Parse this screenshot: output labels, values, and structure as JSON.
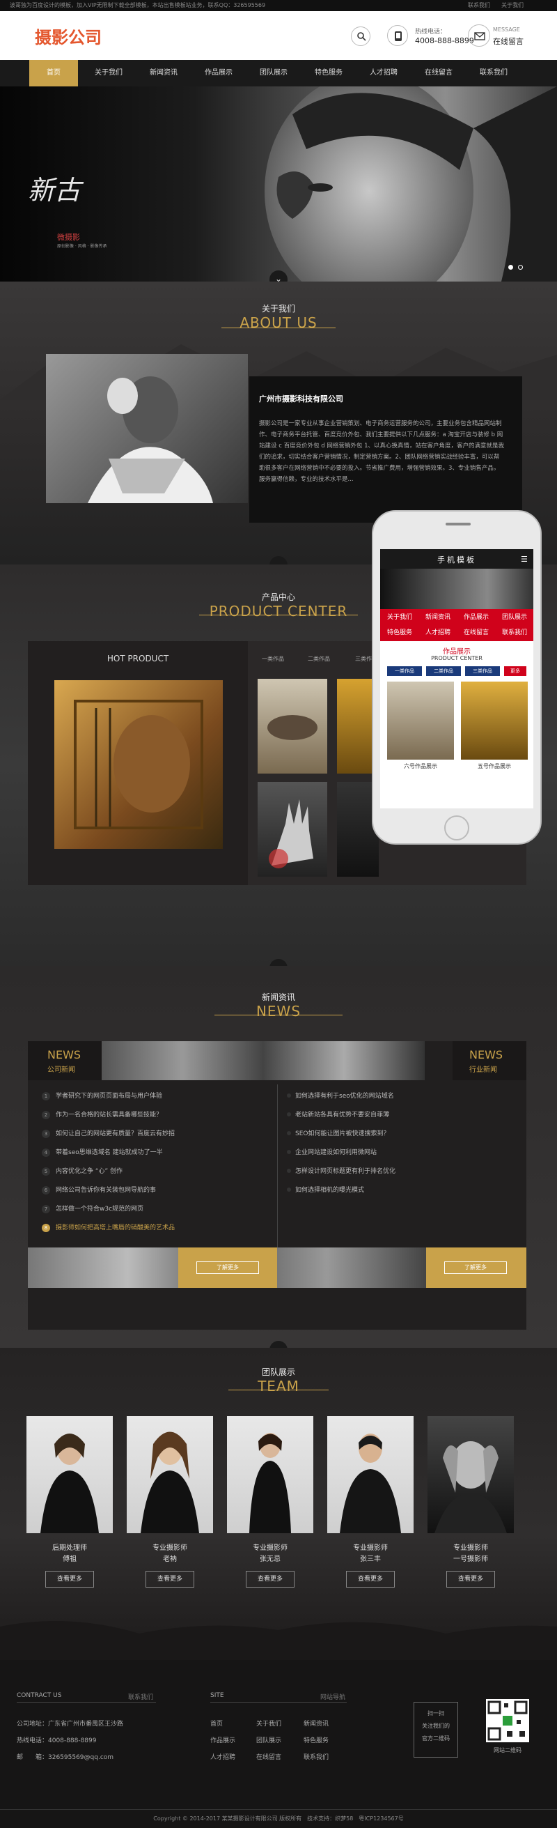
{
  "topbar": {
    "notice": "波哥独为百度设计的模板，加入VIP无限制下载全部模板，本站出售模板站业务，联系QQ：326595569",
    "links": [
      "联系我们",
      "关于我们"
    ]
  },
  "header": {
    "logo": "摄影公司",
    "hotline_label": "热线电话：",
    "hotline_number": "4008-888-8899",
    "message_en": "MESSAGE",
    "message_cn": "在线留言"
  },
  "nav": [
    "首页",
    "关于我们",
    "新闻资讯",
    "作品展示",
    "团队展示",
    "特色服务",
    "人才招聘",
    "在线留言",
    "联系我们"
  ],
  "banner": {
    "calligraphy": "新古",
    "brand": "微摄影",
    "subtitle": "原创影像 · 风格 · 影像传承"
  },
  "about": {
    "title_cn": "关于我们",
    "title_en": "ABOUT US",
    "company": "广州市摄影科技有限公司",
    "text": "摄影公司是一家专业从事企业营销策划、电子商务运营服务的公司，主要业务包含精品网站制作、电子商务平台托管、百度竞价外包、我们主要提供以下几点服务：a 淘宝开店与装修 b 网站建设 c 百度竞价外包 d 网络营销外包 1、以真心换真情，站在客户角度，客户的满意就是我们的追求，切实结合客户营销情况，制定营销方案。2、团队网络营销实战经验丰富，可以帮助很多客户在网络营销中不必要的投入。节省推广费用，增强营销效果。3、专业销售产品，服务赢得信赖，专业的技术水平是..."
  },
  "products": {
    "title_cn": "产品中心",
    "title_en": "PRODUCT CENTER",
    "hot_label": "HOT PRODUCT",
    "tabs": [
      "一类作品",
      "二类作品",
      "三类作品"
    ]
  },
  "phone": {
    "header": "手机模板",
    "menu": [
      "关于我们",
      "新闻资讯",
      "作品展示",
      "团队展示",
      "特色服务",
      "人才招聘",
      "在线留言",
      "联系我们"
    ],
    "section_cn": "作品展示",
    "section_en": "PRODUCT CENTER",
    "tabs": [
      "一类作品",
      "二类作品",
      "三类作品",
      "更多"
    ],
    "items": [
      "六号作品展示",
      "五号作品展示"
    ]
  },
  "news": {
    "title_cn": "新闻资讯",
    "title_en": "NEWS",
    "left_en": "NEWS",
    "left_cn": "公司新闻",
    "right_en": "NEWS",
    "right_cn": "行业新闻",
    "left_items": [
      "学者研究下的网页页面布局与用户体验",
      "作为一名合格的站长需具备哪些技能？",
      "如何让自己的网站更有质量？百度云有妙招",
      "带着seo思维选域名 建站就成功了一半",
      "内容优化之争 “心” 创作",
      "网络公司告诉你有关装包网导航的事",
      "怎样做一个符合w3c规范的网页",
      "摄影师如何把高塔上嘴唇的硝酸美的艺术品"
    ],
    "right_items": [
      "如何选择有利于seo优化的网站域名",
      "老站新站各具有优势不要安自菲薄",
      "SEO如何能让图片被快速搜索到？",
      "企业网站建设如何利用微网站",
      "怎样设计网页标题更有利于排名优化",
      "如何选择相机的曝光模式"
    ],
    "more": "了解更多"
  },
  "team": {
    "title_cn": "团队展示",
    "title_en": "TEAM",
    "members": [
      {
        "role": "后期处理师",
        "name": "傅祖"
      },
      {
        "role": "专业摄影师",
        "name": "老衲"
      },
      {
        "role": "专业摄影师",
        "name": "张无忌"
      },
      {
        "role": "专业摄影师",
        "name": "张三丰"
      },
      {
        "role": "专业摄影师",
        "name": "一号摄影师"
      }
    ],
    "button": "查看更多"
  },
  "footer": {
    "contact_en": "CONTRACT US",
    "contact_cn": "联系我们",
    "address": "公司地址：广东省广州市番禺区王沙路",
    "phone": "热线电话：4008-888-8899",
    "email": "邮　　箱：326595569@qq.com",
    "site_en": "SITE",
    "site_cn": "网站导航",
    "site_links": [
      "首页",
      "关于我们",
      "新闻资讯",
      "作品展示",
      "团队展示",
      "特色服务",
      "人才招聘",
      "在线留言",
      "联系我们"
    ],
    "qr_text_1": "扫一扫",
    "qr_text_2": "关注我们的",
    "qr_text_3": "官方二维码",
    "qr_caption": "网站二维码",
    "copyright": "Copyright © 2014-2017 某某摄影设计有限公司 版权所有　技术支持：织梦58　粤ICP1234567号"
  },
  "colors": {
    "accent": "#c9a24a",
    "logo": "#e4572e",
    "phone_red": "#d0021b"
  }
}
